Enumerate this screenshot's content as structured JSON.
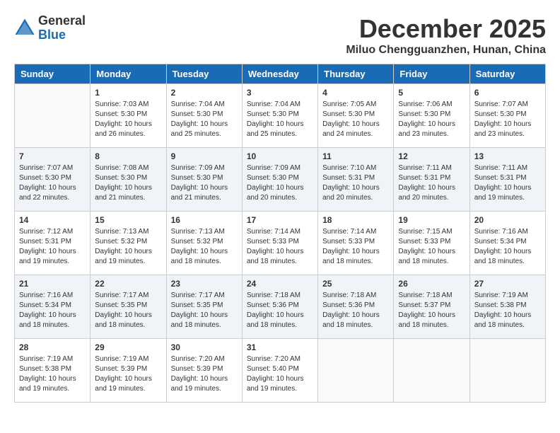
{
  "logo": {
    "general": "General",
    "blue": "Blue"
  },
  "title": {
    "month": "December 2025",
    "location": "Miluo Chengguanzhen, Hunan, China"
  },
  "weekdays": [
    "Sunday",
    "Monday",
    "Tuesday",
    "Wednesday",
    "Thursday",
    "Friday",
    "Saturday"
  ],
  "weeks": [
    [
      {
        "day": "",
        "sunrise": "",
        "sunset": "",
        "daylight": ""
      },
      {
        "day": "1",
        "sunrise": "Sunrise: 7:03 AM",
        "sunset": "Sunset: 5:30 PM",
        "daylight": "Daylight: 10 hours and 26 minutes."
      },
      {
        "day": "2",
        "sunrise": "Sunrise: 7:04 AM",
        "sunset": "Sunset: 5:30 PM",
        "daylight": "Daylight: 10 hours and 25 minutes."
      },
      {
        "day": "3",
        "sunrise": "Sunrise: 7:04 AM",
        "sunset": "Sunset: 5:30 PM",
        "daylight": "Daylight: 10 hours and 25 minutes."
      },
      {
        "day": "4",
        "sunrise": "Sunrise: 7:05 AM",
        "sunset": "Sunset: 5:30 PM",
        "daylight": "Daylight: 10 hours and 24 minutes."
      },
      {
        "day": "5",
        "sunrise": "Sunrise: 7:06 AM",
        "sunset": "Sunset: 5:30 PM",
        "daylight": "Daylight: 10 hours and 23 minutes."
      },
      {
        "day": "6",
        "sunrise": "Sunrise: 7:07 AM",
        "sunset": "Sunset: 5:30 PM",
        "daylight": "Daylight: 10 hours and 23 minutes."
      }
    ],
    [
      {
        "day": "7",
        "sunrise": "Sunrise: 7:07 AM",
        "sunset": "Sunset: 5:30 PM",
        "daylight": "Daylight: 10 hours and 22 minutes."
      },
      {
        "day": "8",
        "sunrise": "Sunrise: 7:08 AM",
        "sunset": "Sunset: 5:30 PM",
        "daylight": "Daylight: 10 hours and 21 minutes."
      },
      {
        "day": "9",
        "sunrise": "Sunrise: 7:09 AM",
        "sunset": "Sunset: 5:30 PM",
        "daylight": "Daylight: 10 hours and 21 minutes."
      },
      {
        "day": "10",
        "sunrise": "Sunrise: 7:09 AM",
        "sunset": "Sunset: 5:30 PM",
        "daylight": "Daylight: 10 hours and 20 minutes."
      },
      {
        "day": "11",
        "sunrise": "Sunrise: 7:10 AM",
        "sunset": "Sunset: 5:31 PM",
        "daylight": "Daylight: 10 hours and 20 minutes."
      },
      {
        "day": "12",
        "sunrise": "Sunrise: 7:11 AM",
        "sunset": "Sunset: 5:31 PM",
        "daylight": "Daylight: 10 hours and 20 minutes."
      },
      {
        "day": "13",
        "sunrise": "Sunrise: 7:11 AM",
        "sunset": "Sunset: 5:31 PM",
        "daylight": "Daylight: 10 hours and 19 minutes."
      }
    ],
    [
      {
        "day": "14",
        "sunrise": "Sunrise: 7:12 AM",
        "sunset": "Sunset: 5:31 PM",
        "daylight": "Daylight: 10 hours and 19 minutes."
      },
      {
        "day": "15",
        "sunrise": "Sunrise: 7:13 AM",
        "sunset": "Sunset: 5:32 PM",
        "daylight": "Daylight: 10 hours and 19 minutes."
      },
      {
        "day": "16",
        "sunrise": "Sunrise: 7:13 AM",
        "sunset": "Sunset: 5:32 PM",
        "daylight": "Daylight: 10 hours and 18 minutes."
      },
      {
        "day": "17",
        "sunrise": "Sunrise: 7:14 AM",
        "sunset": "Sunset: 5:33 PM",
        "daylight": "Daylight: 10 hours and 18 minutes."
      },
      {
        "day": "18",
        "sunrise": "Sunrise: 7:14 AM",
        "sunset": "Sunset: 5:33 PM",
        "daylight": "Daylight: 10 hours and 18 minutes."
      },
      {
        "day": "19",
        "sunrise": "Sunrise: 7:15 AM",
        "sunset": "Sunset: 5:33 PM",
        "daylight": "Daylight: 10 hours and 18 minutes."
      },
      {
        "day": "20",
        "sunrise": "Sunrise: 7:16 AM",
        "sunset": "Sunset: 5:34 PM",
        "daylight": "Daylight: 10 hours and 18 minutes."
      }
    ],
    [
      {
        "day": "21",
        "sunrise": "Sunrise: 7:16 AM",
        "sunset": "Sunset: 5:34 PM",
        "daylight": "Daylight: 10 hours and 18 minutes."
      },
      {
        "day": "22",
        "sunrise": "Sunrise: 7:17 AM",
        "sunset": "Sunset: 5:35 PM",
        "daylight": "Daylight: 10 hours and 18 minutes."
      },
      {
        "day": "23",
        "sunrise": "Sunrise: 7:17 AM",
        "sunset": "Sunset: 5:35 PM",
        "daylight": "Daylight: 10 hours and 18 minutes."
      },
      {
        "day": "24",
        "sunrise": "Sunrise: 7:18 AM",
        "sunset": "Sunset: 5:36 PM",
        "daylight": "Daylight: 10 hours and 18 minutes."
      },
      {
        "day": "25",
        "sunrise": "Sunrise: 7:18 AM",
        "sunset": "Sunset: 5:36 PM",
        "daylight": "Daylight: 10 hours and 18 minutes."
      },
      {
        "day": "26",
        "sunrise": "Sunrise: 7:18 AM",
        "sunset": "Sunset: 5:37 PM",
        "daylight": "Daylight: 10 hours and 18 minutes."
      },
      {
        "day": "27",
        "sunrise": "Sunrise: 7:19 AM",
        "sunset": "Sunset: 5:38 PM",
        "daylight": "Daylight: 10 hours and 18 minutes."
      }
    ],
    [
      {
        "day": "28",
        "sunrise": "Sunrise: 7:19 AM",
        "sunset": "Sunset: 5:38 PM",
        "daylight": "Daylight: 10 hours and 19 minutes."
      },
      {
        "day": "29",
        "sunrise": "Sunrise: 7:19 AM",
        "sunset": "Sunset: 5:39 PM",
        "daylight": "Daylight: 10 hours and 19 minutes."
      },
      {
        "day": "30",
        "sunrise": "Sunrise: 7:20 AM",
        "sunset": "Sunset: 5:39 PM",
        "daylight": "Daylight: 10 hours and 19 minutes."
      },
      {
        "day": "31",
        "sunrise": "Sunrise: 7:20 AM",
        "sunset": "Sunset: 5:40 PM",
        "daylight": "Daylight: 10 hours and 19 minutes."
      },
      {
        "day": "",
        "sunrise": "",
        "sunset": "",
        "daylight": ""
      },
      {
        "day": "",
        "sunrise": "",
        "sunset": "",
        "daylight": ""
      },
      {
        "day": "",
        "sunrise": "",
        "sunset": "",
        "daylight": ""
      }
    ]
  ]
}
